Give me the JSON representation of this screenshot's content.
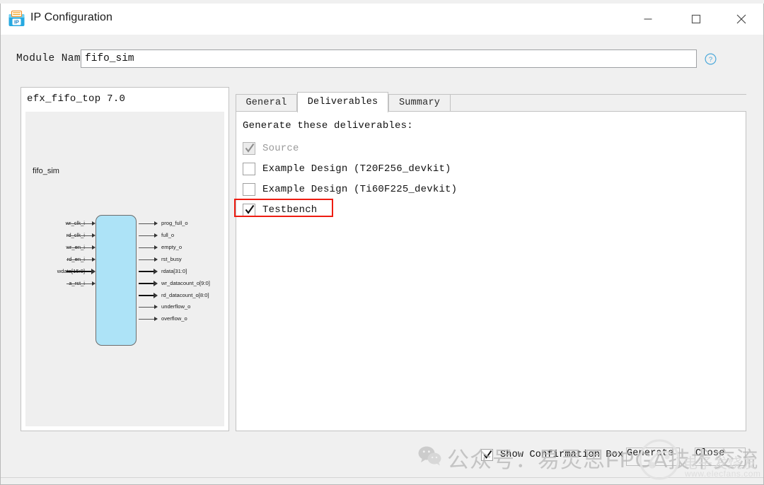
{
  "window": {
    "title": "IP Configuration",
    "icon": "ip-box-icon",
    "controls": {
      "minimize": "minimize-icon",
      "maximize": "maximize-icon",
      "close": "close-icon"
    }
  },
  "top_fragment": "—— ———— ————",
  "module": {
    "label": "Module Name",
    "value": "fifo_sim",
    "placeholder": "",
    "help_icon": "help-circle-icon"
  },
  "preview": {
    "title": "efx_fifo_top 7.0",
    "block_name": "fifo_sim",
    "inputs": [
      "wr_clk_i",
      "rd_clk_i",
      "wr_en_i",
      "rd_en_i",
      "wdata[15:0]",
      "a_rst_i"
    ],
    "input_is_bus": [
      false,
      false,
      false,
      false,
      true,
      false
    ],
    "outputs": [
      "prog_full_o",
      "full_o",
      "empty_o",
      "rst_busy",
      "rdata[31:0]",
      "wr_datacount_o[9:0]",
      "rd_datacount_o[8:0]",
      "underflow_o",
      "overflow_o"
    ],
    "output_is_bus": [
      false,
      false,
      false,
      false,
      true,
      true,
      true,
      false,
      false
    ],
    "block_fill": "#ade3f7",
    "block_stroke": "#6d6d6d"
  },
  "tabs": [
    {
      "label": "General",
      "active": false
    },
    {
      "label": "Deliverables",
      "active": true
    },
    {
      "label": "Summary",
      "active": false
    }
  ],
  "deliverables": {
    "heading": "Generate these deliverables:",
    "items": [
      {
        "label": "Source",
        "checked": true,
        "disabled": true,
        "highlighted": false
      },
      {
        "label": "Example Design (T20F256_devkit)",
        "checked": false,
        "disabled": false,
        "highlighted": false
      },
      {
        "label": "Example Design (Ti60F225_devkit)",
        "checked": false,
        "disabled": false,
        "highlighted": false
      },
      {
        "label": "Testbench",
        "checked": true,
        "disabled": false,
        "highlighted": true
      }
    ],
    "highlight_color": "#ee1c11"
  },
  "footer": {
    "confirmation": {
      "label": "Show Confirmation Box",
      "checked": true
    },
    "generate_label": "Generate",
    "close_label": "Close"
  },
  "watermarks": {
    "wechat_icon": "wechat-logo-icon",
    "wechat_text": "公众号：易灵思FPGA技术交流",
    "elecfans_name": "电子发烧友",
    "elecfans_url": "www.elecfans.com"
  }
}
